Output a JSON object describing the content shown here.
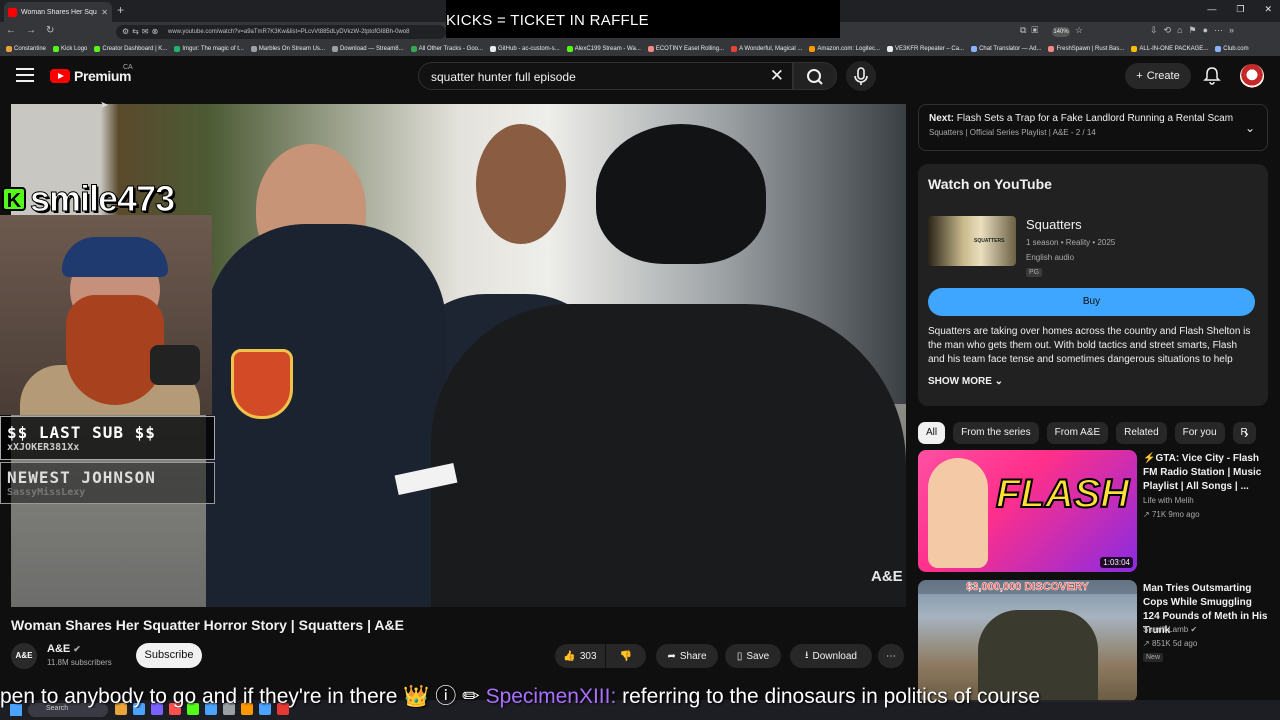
{
  "browser": {
    "tab_title": "Woman Shares Her Squatt",
    "url": "www.youtube.com/watch?v=a9aTmR7K3Kw&list=PLcvVt885dLyDVkzW-2tptofGI8Bh-0wo8",
    "zoom": "140%",
    "bookmarks": [
      "Constantine",
      "Kick Logo",
      "Creator Dashboard | K...",
      "Imgur: The magic of t...",
      "Marbles On Stream Us...",
      "Download — Stream8...",
      "All Other Tracks - Goo...",
      "GitHub - ac-custom-s...",
      "AlexC199 Stream - Wa...",
      "ECOTINY Easel Rolling...",
      "A Wonderful, Magical ...",
      "Amazon.com: Logitec...",
      "VE3KFR Repeater – Ca...",
      "Chat Translator — Ad...",
      "FreshSpawn | Rust Bas...",
      "ALL-IN-ONE PACKAGE...",
      "Club.com"
    ]
  },
  "overlay": {
    "raffle_banner": "KICKS = TICKET IN RAFFLE",
    "kick_username": "smile473",
    "last_sub_header": "$$ LAST SUB $$",
    "last_sub_name": "xXJOKER381Xx",
    "newest_header": "NEWEST JOHNSON",
    "newest_name": "SassyMissLexy",
    "chat_text": "pen to anybody to go and if they're in there ",
    "chat_emotes": "👑 ⓘ ✏",
    "chat_user": "SpecimenXIII:",
    "chat_message": " referring to the dinosaurs in politics of course"
  },
  "header": {
    "logo_text": "Premium",
    "country": "CA",
    "search_value": "squatter hunter full episode",
    "create_label": "Create"
  },
  "video": {
    "watermark": "A&E",
    "title": "Woman Shares Her Squatter Horror Story | Squatters | A&E",
    "channel": "A&E",
    "channel_avatar": "A&E",
    "subscribers": "11.8M subscribers",
    "subscribe_label": "Subscribe",
    "likes": "303",
    "share_label": "Share",
    "save_label": "Save",
    "download_label": "Download"
  },
  "sidebar": {
    "next_label": "Next:",
    "next_title": "Flash Sets a Trap for a Fake Landlord Running a Rental Scam |...",
    "next_playlist": "Squatters | Official Series Playlist | A&E - 2 / 14",
    "watch_heading": "Watch on YouTube",
    "show_thumb_text": "SQUATTERS",
    "show_title": "Squatters",
    "show_meta": "1 season • Reality • 2025",
    "show_audio": "English audio",
    "show_rating": "PG",
    "buy_label": "Buy",
    "description": "Squatters are taking over homes across the country and Flash Shelton is the man who gets them out. With bold tactics and street smarts, Flash and his team face tense and sometimes dangerous situations to help families...",
    "show_more": "SHOW MORE",
    "chips": [
      "All",
      "From the series",
      "From A&E",
      "Related",
      "For you",
      "R"
    ],
    "recs": [
      {
        "title": "GTA: Vice City - Flash FM Radio Station | Music Playlist | All Songs | ...",
        "channel": "Life with Melih",
        "meta": "71K  9mo ago",
        "duration": "1:03:04",
        "thumb_text": "FLASH"
      },
      {
        "title": "Man Tries Outsmarting Cops While Smuggling 124 Pounds of Meth in His Trunk",
        "channel": "Sheriff Lamb",
        "meta": "851K  5d ago",
        "badge": "New",
        "thumb_text": "$3,000,000 DISCOVERY"
      }
    ]
  },
  "taskbar": {
    "search_placeholder": "Search"
  }
}
